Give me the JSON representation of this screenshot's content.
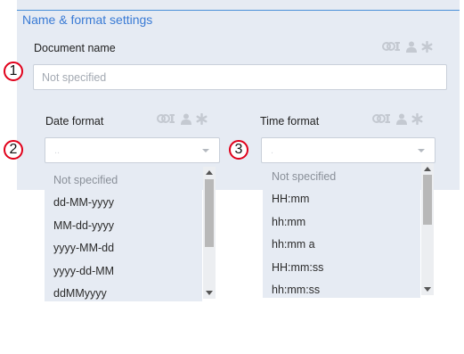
{
  "section": {
    "title": "Name & format settings"
  },
  "document_name": {
    "label": "Document name",
    "placeholder": "Not specified",
    "value": ""
  },
  "date_format": {
    "label": "Date format",
    "selected_placeholder": "..",
    "options": [
      "Not specified",
      "dd-MM-yyyy",
      "MM-dd-yyyy",
      "yyyy-MM-dd",
      "yyyy-dd-MM",
      "ddMMyyyy"
    ]
  },
  "time_format": {
    "label": "Time format",
    "selected_placeholder": ".",
    "options": [
      "Not specified",
      "HH:mm",
      "hh:mm",
      "hh:mm a",
      "HH:mm:ss",
      "hh:mm:ss"
    ]
  },
  "badges": {
    "one": "1",
    "two": "2",
    "three": "3"
  },
  "field_icons": [
    "link-text-icon",
    "person-icon",
    "asterisk-icon"
  ],
  "colors": {
    "accent": "#3a7bd5",
    "panel_bg": "#e6ebf3",
    "badge_ring": "#e0001a",
    "icon_gray": "#c4c9d1"
  }
}
